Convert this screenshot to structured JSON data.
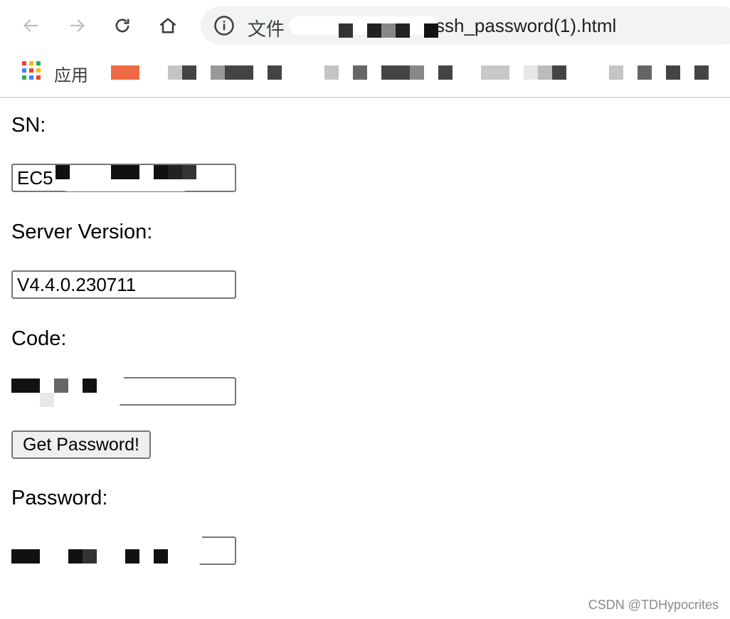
{
  "browser": {
    "omnibox": {
      "scheme_label": "文件",
      "url_visible": "ssh_password(1).html",
      "info_icon": "info-circle-icon"
    },
    "nav": {
      "back_icon": "arrow-left-icon",
      "forward_icon": "arrow-right-icon",
      "reload_icon": "reload-icon",
      "home_icon": "home-icon"
    },
    "bookmarks": {
      "apps_label": "应用",
      "apps_icon": "apps-grid-icon"
    }
  },
  "form": {
    "sn_label": "SN:",
    "sn_value": "EC5",
    "server_version_label": "Server Version:",
    "server_version_value": "V4.4.0.230711",
    "code_label": "Code:",
    "code_value": "",
    "submit_label": "Get Password!",
    "password_label": "Password:",
    "password_value": ""
  },
  "watermark": "CSDN @TDHypocrites",
  "colors": {
    "omnibox_bg": "#f1f3f4",
    "button_bg": "#efefef",
    "border": "#767676",
    "bookmark_accent": "#ee6a44"
  }
}
